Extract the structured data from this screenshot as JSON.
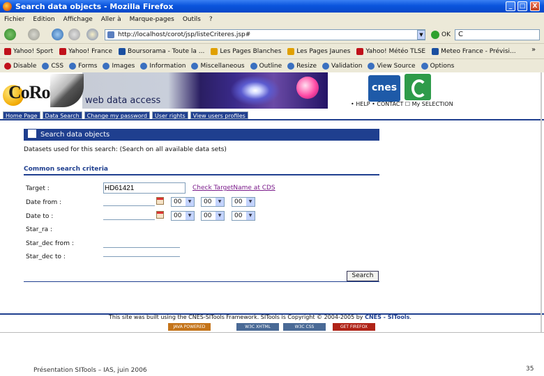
{
  "window": {
    "title": "Search data objects - Mozilla Firefox",
    "minimize": "_",
    "maximize": "□",
    "close": "X"
  },
  "menu": [
    "Fichier",
    "Edition",
    "Affichage",
    "Aller à",
    "Marque-pages",
    "Outils",
    "?"
  ],
  "nav": {
    "url": "http://localhost/corot/jsp/listeCriteres.jsp#",
    "go_label": "OK",
    "search_value": "C"
  },
  "bookmarks": [
    {
      "label": "Yahoo! Sport",
      "color": "#c0101a"
    },
    {
      "label": "Yahoo! France",
      "color": "#c0101a"
    },
    {
      "label": "Boursorama - Toute la ...",
      "color": "#1a4fa0"
    },
    {
      "label": "Les Pages Blanches",
      "color": "#e0a000"
    },
    {
      "label": "Les Pages Jaunes",
      "color": "#e0a000"
    },
    {
      "label": "Yahoo! Météo TLSE",
      "color": "#c0101a"
    },
    {
      "label": "Meteo France - Prévisi...",
      "color": "#1a4fa0"
    }
  ],
  "bookmarks_more": "»",
  "webdev": [
    {
      "label": "Disable",
      "color": "#c0101a"
    },
    {
      "label": "CSS",
      "color": "#3a70c0"
    },
    {
      "label": "Forms",
      "color": "#3a70c0"
    },
    {
      "label": "Images",
      "color": "#3a70c0"
    },
    {
      "label": "Information",
      "color": "#3a70c0"
    },
    {
      "label": "Miscellaneous",
      "color": "#3a70c0"
    },
    {
      "label": "Outline",
      "color": "#3a70c0"
    },
    {
      "label": "Resize",
      "color": "#3a70c0"
    },
    {
      "label": "Validation",
      "color": "#3a70c0"
    },
    {
      "label": "View Source",
      "color": "#3a70c0"
    },
    {
      "label": "Options",
      "color": "#3a70c0"
    }
  ],
  "site": {
    "logo_text": "CoRoT",
    "banner_title": "web data access",
    "cnes_label": "cnes",
    "header_links": "• HELP • CONTACT ☐ My SELECTION",
    "nav_items": [
      "Home Page",
      "Data Search",
      "Change my password",
      "User rights",
      "View users profiles"
    ]
  },
  "form": {
    "title": "Search data objects",
    "datasets_line": "Datasets used for this search: (Search on all available data sets)",
    "section_title": "Common search criteria",
    "target_label": "Target :",
    "target_value": "HD61421",
    "check_link": "Check TargetName at CDS",
    "date_from_label": "Date from :",
    "date_to_label": "Date to :",
    "time_default": "00",
    "star_ra_label": "Star_ra :",
    "star_dec_from_label": "Star_dec from :",
    "star_dec_to_label": "Star_dec to :",
    "search_button": "Search"
  },
  "footer": {
    "text_before": "This site was built using the CNES-SITools Framework. SITools is Copyright © 2004-2005 by ",
    "text_link": "CNES - SITools",
    "text_after": ".",
    "badges": [
      {
        "label": "JAVA POWERED",
        "color": "#c4741a"
      },
      {
        "label": "W3C XHTML",
        "color": "#4a6a96"
      },
      {
        "label": "W3C CSS",
        "color": "#4a6a96"
      },
      {
        "label": "GET FIREFOX",
        "color": "#b02418"
      }
    ]
  },
  "slide": {
    "footer": "Présentation SITools – IAS, juin 2006",
    "number": "35"
  }
}
